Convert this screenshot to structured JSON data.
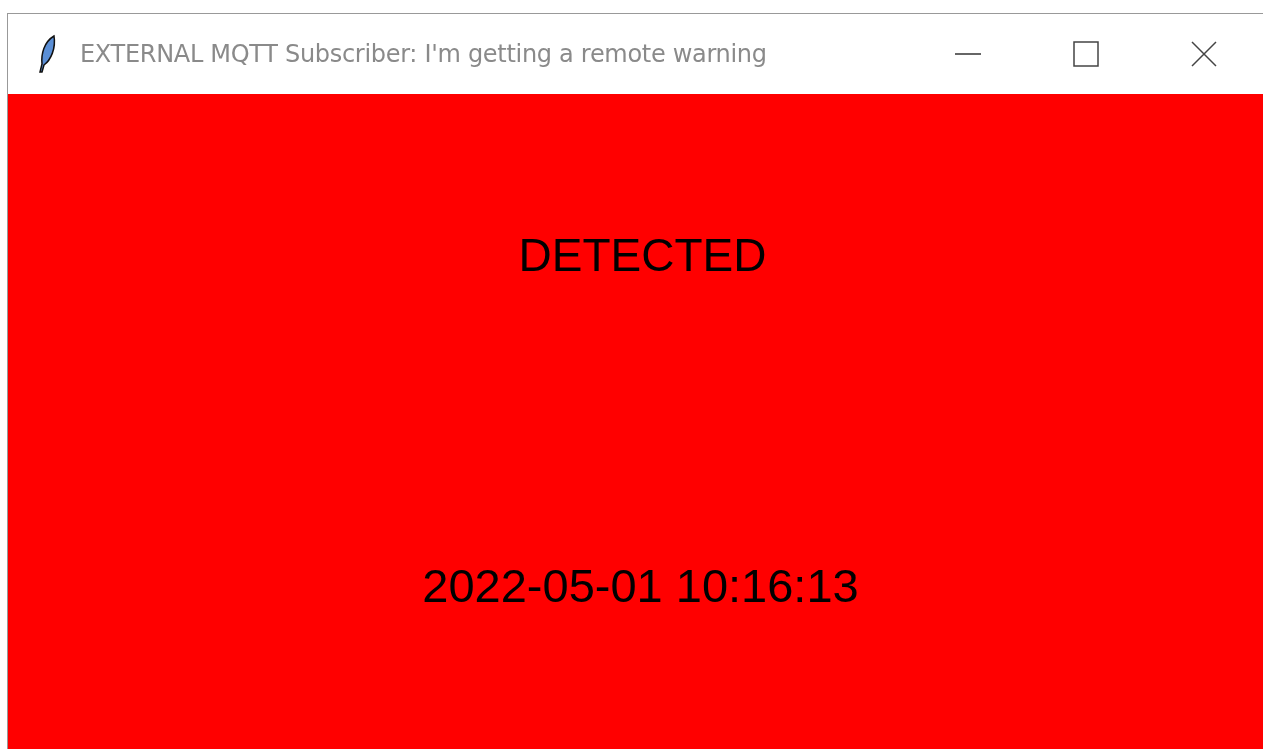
{
  "window": {
    "title": "EXTERNAL MQTT Subscriber: I'm getting a remote warning"
  },
  "status": {
    "text": "DETECTED"
  },
  "timestamp": "2022-05-01 10:16:13"
}
